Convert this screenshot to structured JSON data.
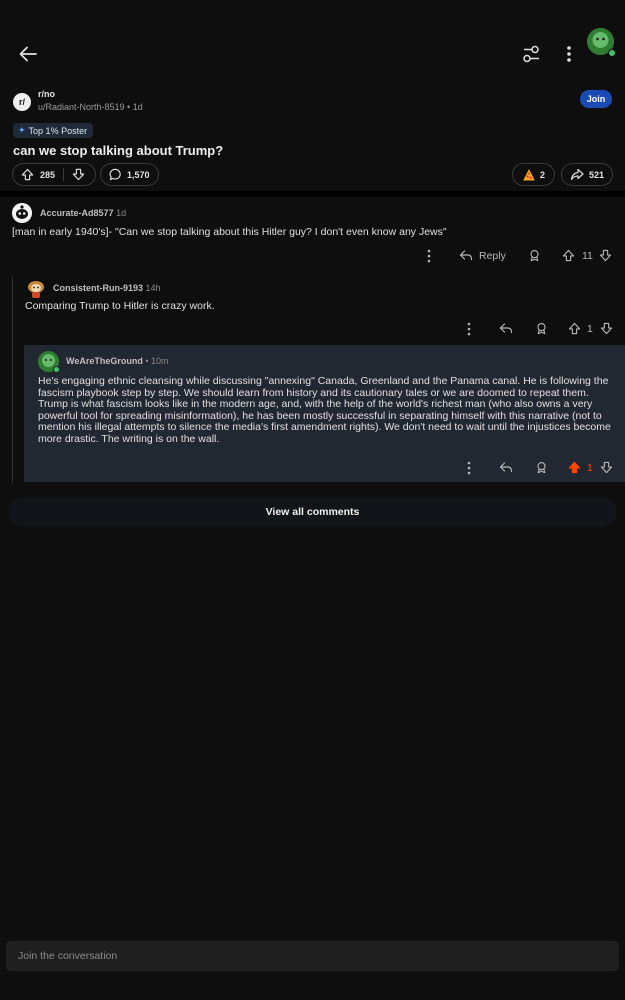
{
  "post": {
    "subreddit": "r/no",
    "author_meta": "u/Radiant-North-8519 • 1d",
    "join_label": "Join",
    "flair": "Top 1% Poster",
    "title": "can we stop talking about Trump?",
    "upvotes": "285",
    "comments": "1,570",
    "awards": "2",
    "shares": "521"
  },
  "comments": [
    {
      "author": "Accurate-Ad8577",
      "time": "1d",
      "body": "[man in early 1940's]- \"Can we stop talking about this Hitler guy? I don't even know any Jews\"",
      "reply_label": "Reply",
      "score": "11"
    },
    {
      "author": "Consistent-Run-9193",
      "time": "14h",
      "body": "Comparing Trump to Hitler is crazy work.",
      "score": "1"
    },
    {
      "author": "WeAreTheGround",
      "time": "• 10m",
      "body": "He's engaging ethnic cleansing while discussing \"annexing\" Canada, Greenland and the Panama canal. He is following the fascism playbook step by step. We should learn from history and its cautionary tales or we are doomed to repeat them. Trump is what fascism looks like in the modern age, and, with the help of the world's richest man (who also owns a very powerful tool for spreading misinformation), he has been mostly successful in separating himself with this narrative (not to mention his illegal attempts to silence the media's first amendment rights). We don't need to wait until the injustices become more drastic. The writing is on the wall.",
      "score": "1",
      "upvoted": true
    }
  ],
  "view_all_label": "View all comments",
  "compose": {
    "placeholder": "Join the conversation"
  },
  "icons": {
    "back": "arrow-left-icon",
    "filter": "sort-filter-icon",
    "more": "more-vertical-icon",
    "upvote": "arrow-up-icon",
    "downvote": "arrow-down-icon",
    "comment": "speech-bubble-icon",
    "award": "award-icon",
    "share": "share-arrow-icon",
    "reply": "reply-arrow-icon",
    "save": "award-ribbon-icon"
  },
  "colors": {
    "background": "#0e0e0e",
    "join_button": "#1a4bb5",
    "highlight": "#222832",
    "upvoted": "#ff4500",
    "online": "#3ec36c"
  }
}
